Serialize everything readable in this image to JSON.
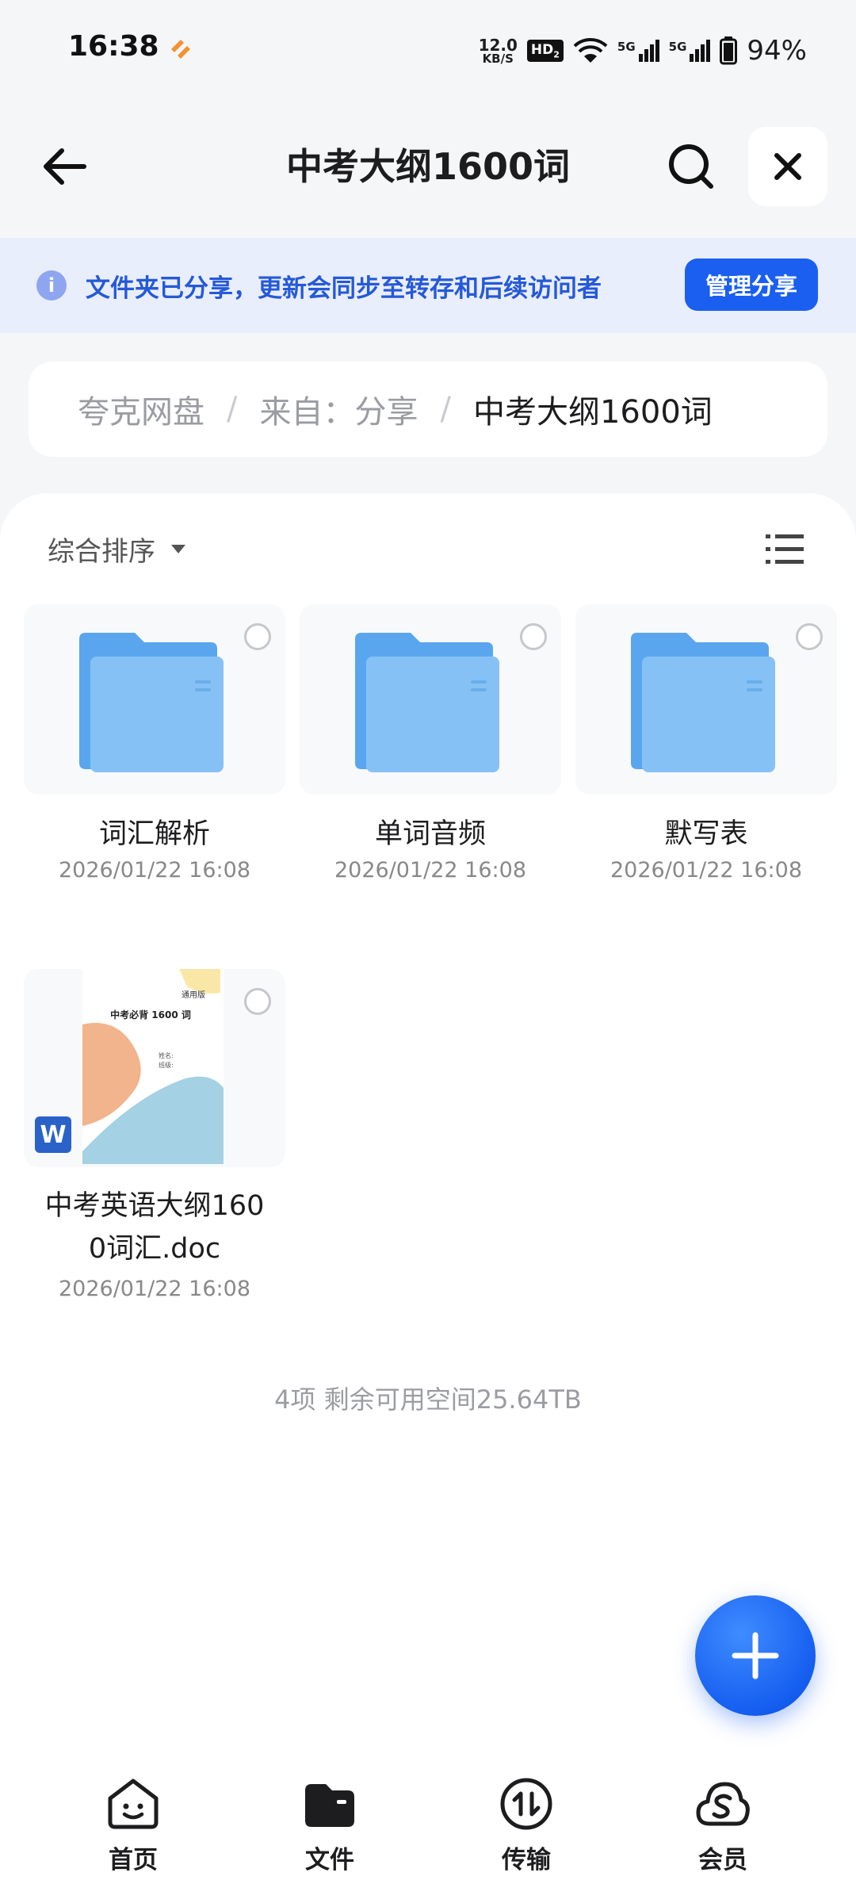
{
  "status_bar": {
    "time": "16:38",
    "net_speed_value": "12.0",
    "net_speed_unit": "KB/S",
    "hd_label": "HD",
    "hd_sub": "2",
    "signal_1_label": "5G",
    "signal_2_label": "5G",
    "battery": "94%"
  },
  "header": {
    "title": "中考大纲1600词"
  },
  "share_banner": {
    "text": "文件夹已分享，更新会同步至转存和后续访问者",
    "button_label": "管理分享"
  },
  "breadcrumb": [
    "夸克网盘",
    "来自：分享",
    "中考大纲1600词"
  ],
  "breadcrumb_separator": "/",
  "toolbar": {
    "sort_label": "综合排序"
  },
  "files": [
    {
      "name": "词汇解析",
      "date": "2026/01/22 16:08",
      "type": "folder"
    },
    {
      "name": "单词音频",
      "date": "2026/01/22 16:08",
      "type": "folder"
    },
    {
      "name": "默写表",
      "date": "2026/01/22 16:08",
      "type": "folder"
    },
    {
      "name_line1": "中考英语大纲160",
      "name_line2": "0词汇.doc",
      "date": "2026/01/22 16:08",
      "type": "doc",
      "preview": {
        "badge": "通用版",
        "title": "中考必背 1600 词",
        "field1": "姓名:",
        "field2": "班级:"
      },
      "file_badge": "W"
    }
  ],
  "summary": "4项 剩余可用空间25.64TB",
  "tabs": [
    {
      "label": "首页",
      "icon": "home-face-icon"
    },
    {
      "label": "文件",
      "icon": "folder-filled-icon"
    },
    {
      "label": "传输",
      "icon": "transfer-icon"
    },
    {
      "label": "会员",
      "icon": "cloud-member-icon"
    }
  ],
  "colors": {
    "accent": "#1a5ff0",
    "banner_bg": "#e9eefc",
    "banner_text": "#2559d8",
    "folder_blue": "#6fb3f2"
  }
}
